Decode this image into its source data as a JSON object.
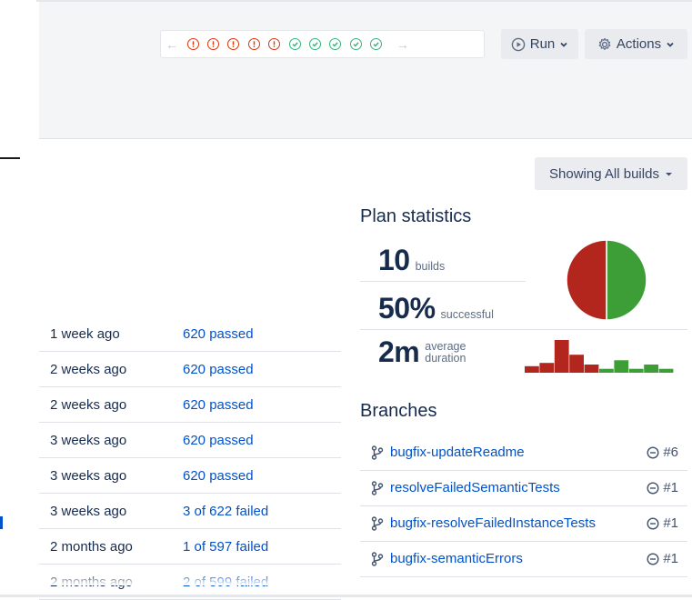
{
  "build_strip": {
    "prev_arrow": "←",
    "next_arrow": "→",
    "statuses": [
      "failed",
      "failed",
      "failed",
      "failed",
      "failed",
      "passed",
      "passed",
      "passed",
      "passed",
      "passed"
    ]
  },
  "toolbar": {
    "run_label": "Run",
    "actions_label": "Actions"
  },
  "filter": {
    "showing_label": "Showing All builds"
  },
  "history": [
    {
      "when": "1 week ago",
      "result": "620 passed"
    },
    {
      "when": "2 weeks ago",
      "result": "620 passed"
    },
    {
      "when": "2 weeks ago",
      "result": "620 passed"
    },
    {
      "when": "3 weeks ago",
      "result": "620 passed"
    },
    {
      "when": "3 weeks ago",
      "result": "620 passed"
    },
    {
      "when": "3 weeks ago",
      "result": "3 of 622 failed"
    },
    {
      "when": "2 months ago",
      "result": "1 of 597 failed"
    },
    {
      "when": "2 months ago",
      "result": "2 of 599 failed"
    }
  ],
  "plan_statistics": {
    "title": "Plan statistics",
    "builds_value": "10",
    "builds_label": "builds",
    "success_value": "50%",
    "success_label": "successful",
    "duration_value": "2m",
    "duration_label_1": "average",
    "duration_label_2": "duration",
    "success_fraction": 0.5,
    "colors": {
      "failed": "#b3261e",
      "passed": "#3d9e37"
    },
    "duration_histogram": [
      {
        "color": "failed",
        "level": 0.2
      },
      {
        "color": "failed",
        "level": 0.3
      },
      {
        "color": "failed",
        "level": 1.0
      },
      {
        "color": "failed",
        "level": 0.55
      },
      {
        "color": "failed",
        "level": 0.25
      },
      {
        "color": "passed",
        "level": 0.12
      },
      {
        "color": "passed",
        "level": 0.38
      },
      {
        "color": "passed",
        "level": 0.12
      },
      {
        "color": "passed",
        "level": 0.25
      },
      {
        "color": "passed",
        "level": 0.12
      }
    ]
  },
  "branches": {
    "title": "Branches",
    "items": [
      {
        "name": "bugfix-updateReadme",
        "status": "#6"
      },
      {
        "name": "resolveFailedSemanticTests",
        "status": "#1"
      },
      {
        "name": "bugfix-resolveFailedInstanceTests",
        "status": "#1"
      },
      {
        "name": "bugfix-semanticErrors",
        "status": "#1"
      }
    ]
  }
}
